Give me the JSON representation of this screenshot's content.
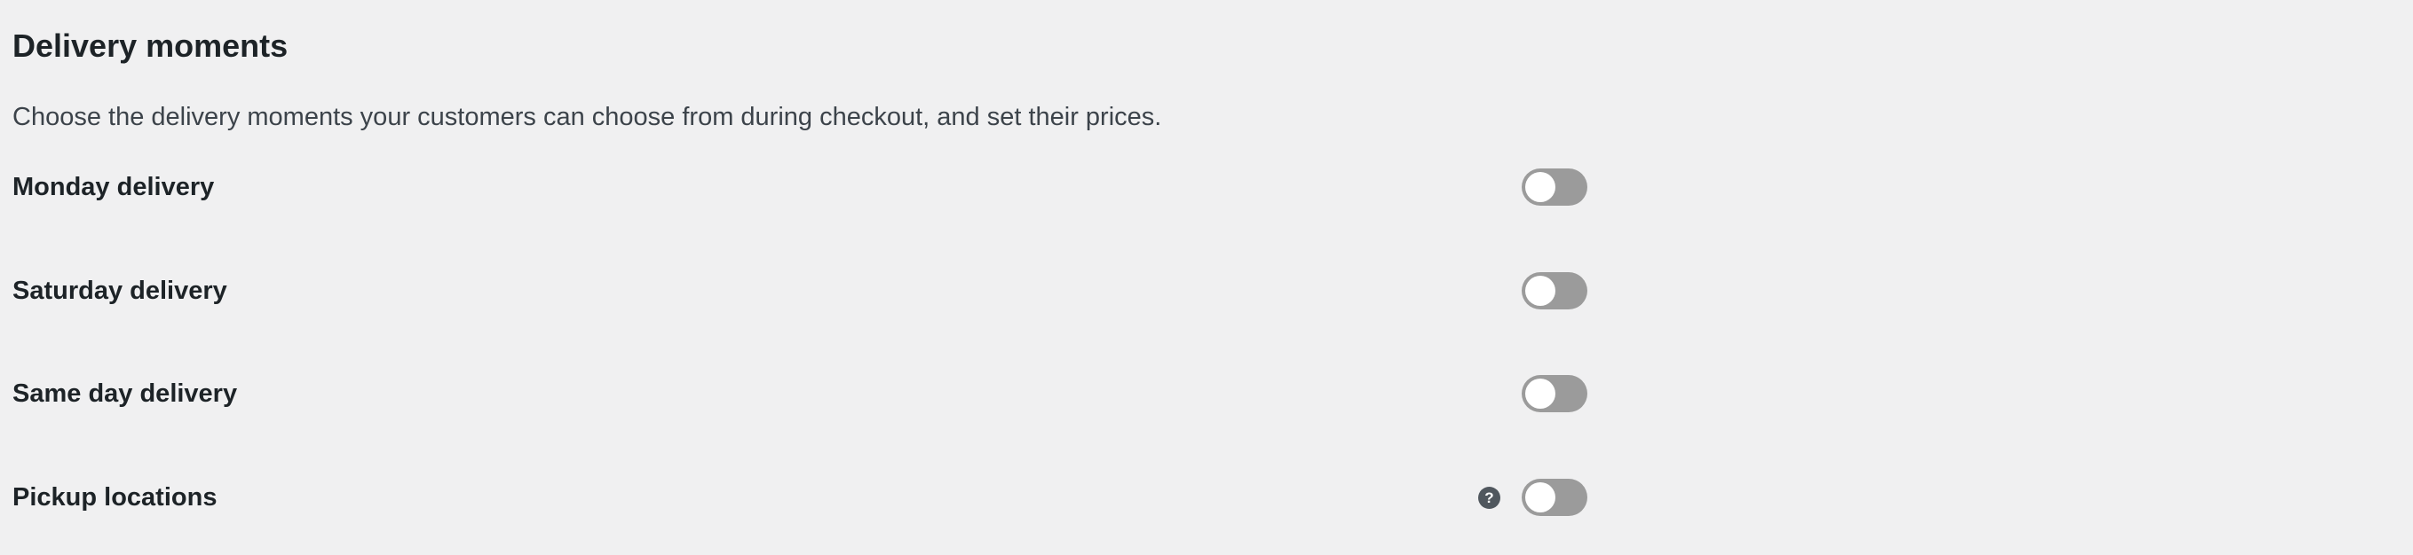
{
  "section": {
    "title": "Delivery moments",
    "description": "Choose the delivery moments your customers can choose from during checkout, and set their prices."
  },
  "options": [
    {
      "label": "Monday delivery",
      "enabled": false,
      "has_help": false
    },
    {
      "label": "Saturday delivery",
      "enabled": false,
      "has_help": false
    },
    {
      "label": "Same day delivery",
      "enabled": false,
      "has_help": false
    },
    {
      "label": "Pickup locations",
      "enabled": false,
      "has_help": true,
      "help_icon": "question-circle-icon",
      "help_glyph": "?"
    }
  ],
  "colors": {
    "background": "#f0f0f1",
    "toggle_off": "#9b9b9b",
    "toggle_knob": "#ffffff",
    "help_icon": "#50575e"
  }
}
